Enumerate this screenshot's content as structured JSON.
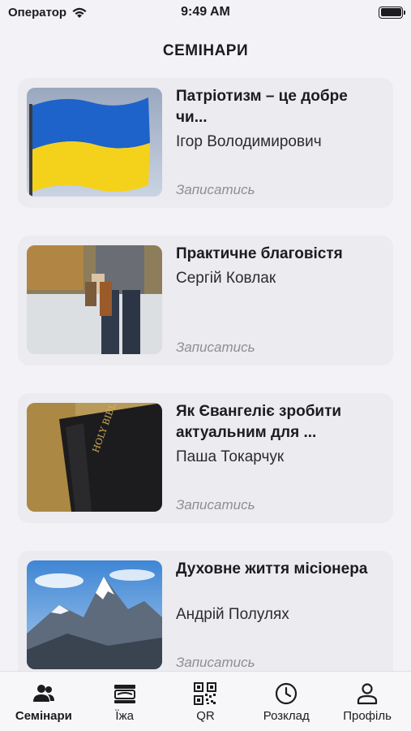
{
  "status": {
    "carrier": "Оператор",
    "time": "9:49 AM"
  },
  "header": {
    "title": "СЕМІНАРИ"
  },
  "seminars": [
    {
      "title": "Патріотизм – це добре чи...",
      "author": "Ігор Володимирович",
      "signup": "Записатись",
      "image": "ukraine-flag-image"
    },
    {
      "title": "Практичне благовістя",
      "author": "Сергій Ковлак",
      "signup": "Записатись",
      "image": "man-with-book-image"
    },
    {
      "title": "Як Євангеліє зробити актуальним для ...",
      "author": "Паша Токарчук",
      "signup": "Записатись",
      "image": "holy-bible-image"
    },
    {
      "title": "Духовне життя місіонера",
      "author": "Андрій Полулях",
      "signup": "Записатись",
      "image": "mountain-image"
    }
  ],
  "tabs": [
    {
      "label": "Семінари",
      "icon": "people-icon",
      "active": true
    },
    {
      "label": "Їжа",
      "icon": "food-icon",
      "active": false
    },
    {
      "label": "QR",
      "icon": "qr-code-icon",
      "active": false
    },
    {
      "label": "Розклад",
      "icon": "clock-icon",
      "active": false
    },
    {
      "label": "Профіль",
      "icon": "person-icon",
      "active": false
    }
  ]
}
